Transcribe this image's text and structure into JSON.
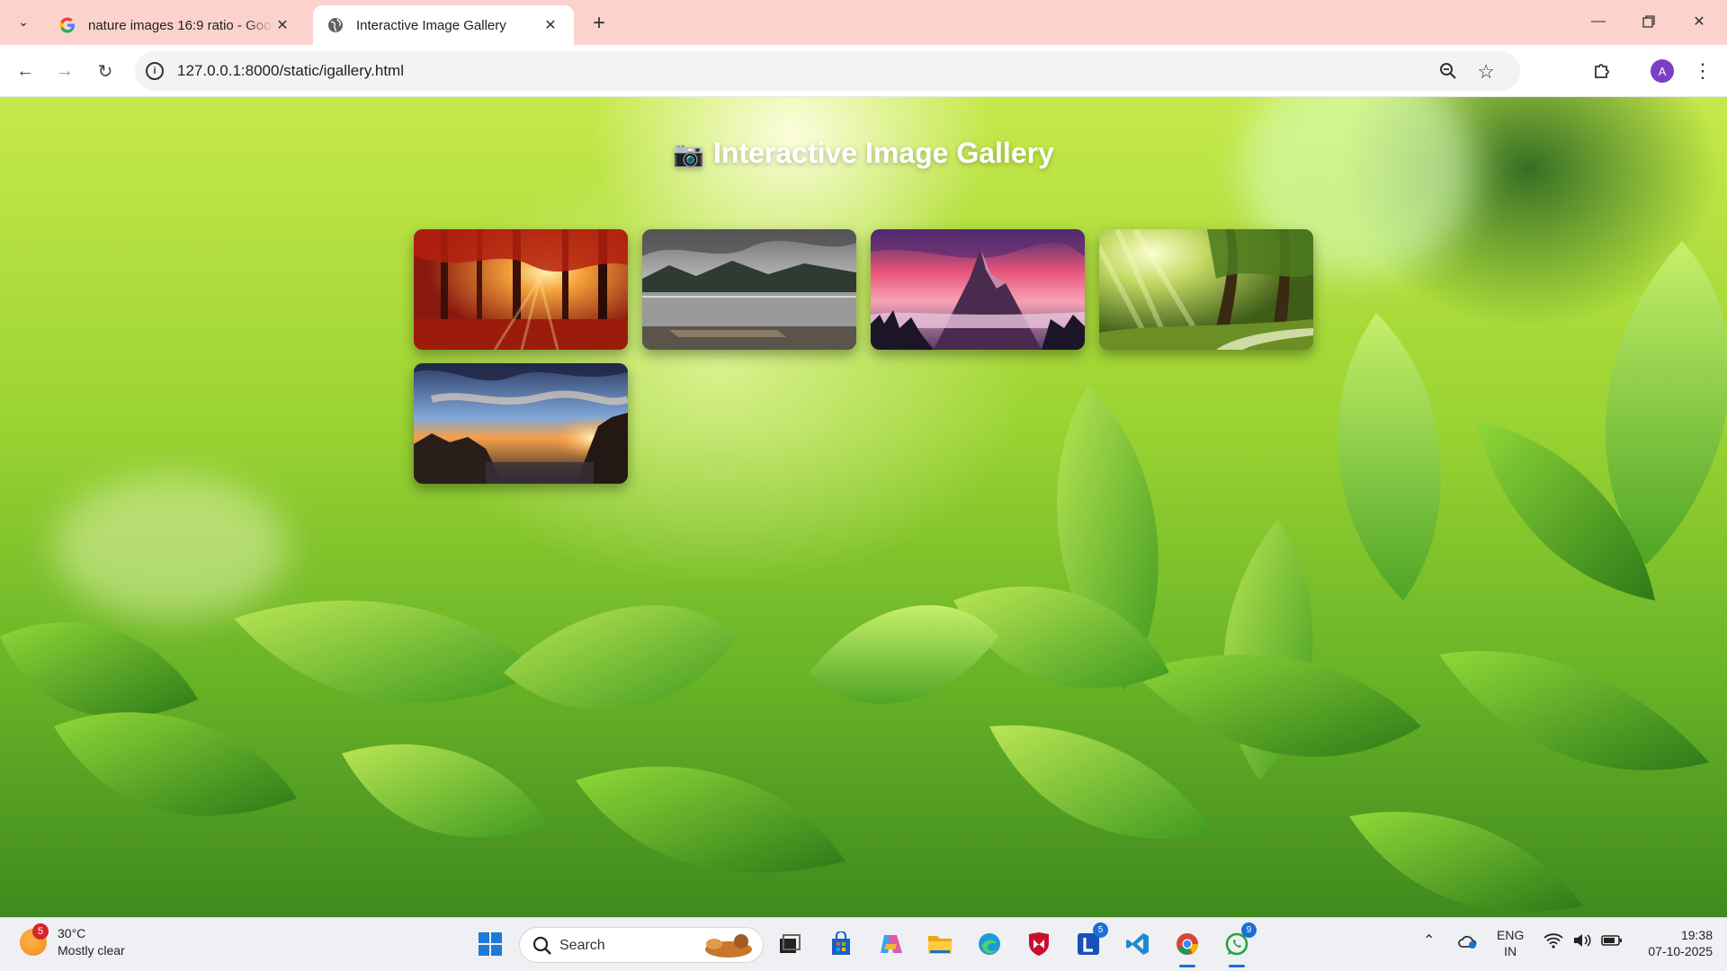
{
  "browser": {
    "tabs": [
      {
        "title": "nature images 16:9 ratio - Google Search",
        "favicon": "google-g-icon",
        "active": false
      },
      {
        "title": "Interactive Image Gallery",
        "favicon": "globe-icon",
        "active": true
      }
    ],
    "url": "127.0.0.1:8000/static/igallery.html",
    "profile_initial": "A"
  },
  "page": {
    "title": "Interactive Image Gallery",
    "title_icon": "camera-icon",
    "images": [
      {
        "name": "autumn-forest-sunlight"
      },
      {
        "name": "misty-lake-shore"
      },
      {
        "name": "pink-mountain-peak"
      },
      {
        "name": "sunlit-green-forest-path"
      },
      {
        "name": "coastal-sunset-rocks"
      }
    ]
  },
  "taskbar": {
    "weather": {
      "temp": "30°C",
      "condition": "Mostly clear",
      "badge": "5"
    },
    "search_label": "Search",
    "apps": [
      {
        "name": "start-icon"
      },
      {
        "name": "task-view-icon"
      },
      {
        "name": "microsoft-store-icon"
      },
      {
        "name": "copilot-icon"
      },
      {
        "name": "file-explorer-icon"
      },
      {
        "name": "edge-icon"
      },
      {
        "name": "mcafee-icon"
      },
      {
        "name": "lens-app-icon",
        "badge": "5"
      },
      {
        "name": "vscode-icon"
      },
      {
        "name": "chrome-icon"
      },
      {
        "name": "whatsapp-icon",
        "badge": "9"
      }
    ],
    "language": {
      "line1": "ENG",
      "line2": "IN"
    },
    "time": "19:38",
    "date": "07-10-2025"
  }
}
